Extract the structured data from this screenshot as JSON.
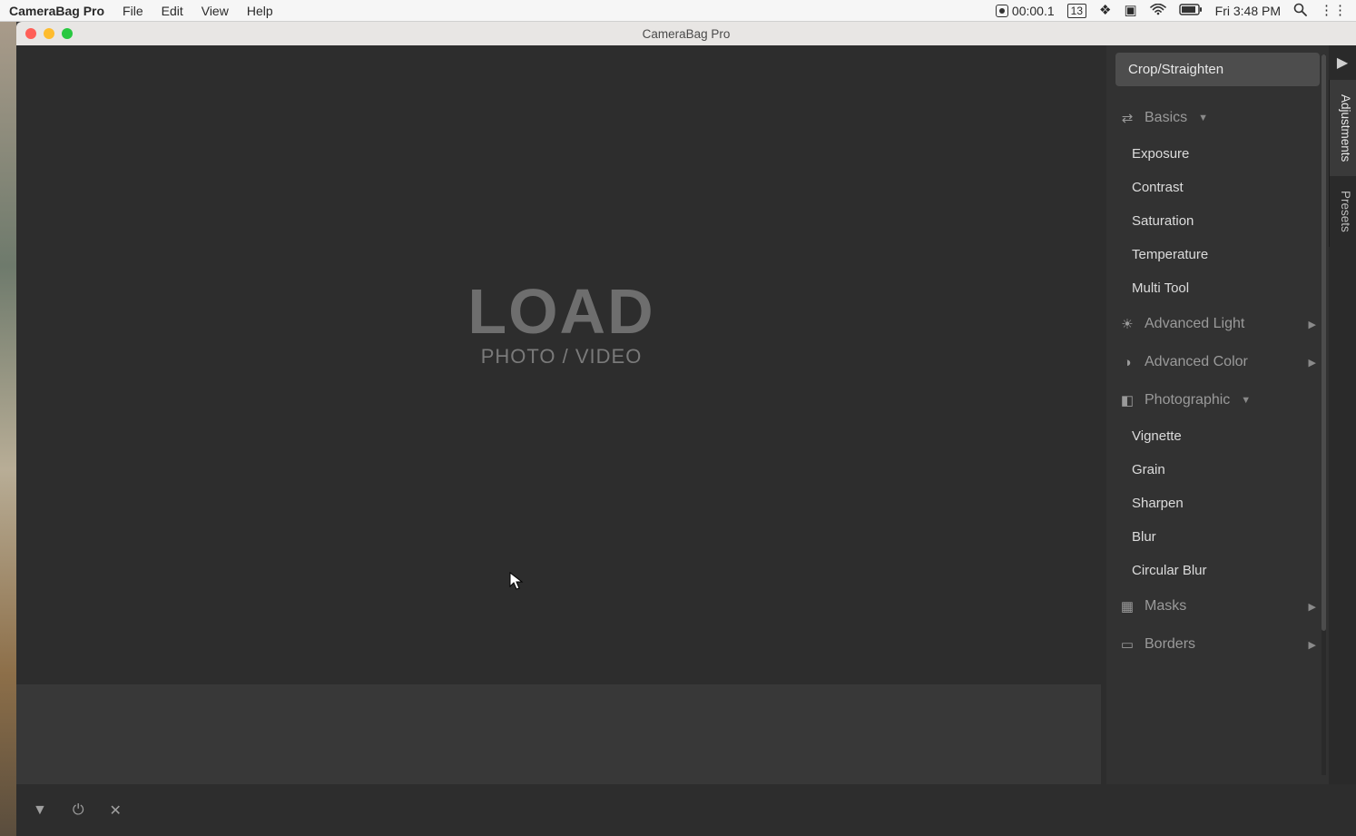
{
  "menubar": {
    "app": "CameraBag Pro",
    "items": [
      "File",
      "Edit",
      "View",
      "Help"
    ],
    "rec_time": "00:00.1",
    "date_badge": "13",
    "clock": "Fri 3:48 PM"
  },
  "window": {
    "title": "CameraBag Pro"
  },
  "canvas": {
    "load_big": "LOAD",
    "load_sub": "PHOTO / VIDEO"
  },
  "panel": {
    "crop": "Crop/Straighten",
    "sections": [
      {
        "icon": "sliders-icon",
        "label": "Basics",
        "expanded": true,
        "arrow": "down",
        "items": [
          "Exposure",
          "Contrast",
          "Saturation",
          "Temperature",
          "Multi Tool"
        ]
      },
      {
        "icon": "sun-icon",
        "label": "Advanced Light",
        "expanded": false,
        "arrow": "right",
        "items": []
      },
      {
        "icon": "palette-icon",
        "label": "Advanced Color",
        "expanded": false,
        "arrow": "right",
        "items": []
      },
      {
        "icon": "camera-icon",
        "label": "Photographic",
        "expanded": true,
        "arrow": "down",
        "items": [
          "Vignette",
          "Grain",
          "Sharpen",
          "Blur",
          "Circular Blur"
        ]
      },
      {
        "icon": "checker-icon",
        "label": "Masks",
        "expanded": false,
        "arrow": "right",
        "items": []
      },
      {
        "icon": "frame-icon",
        "label": "Borders",
        "expanded": false,
        "arrow": "right",
        "items": []
      }
    ]
  },
  "tabs": {
    "collapse": "▶",
    "adjustments": "Adjustments",
    "presets": "Presets"
  },
  "footer": {
    "arrow": "▼",
    "power": "⏻",
    "close": "✕"
  },
  "icon_glyphs": {
    "sliders-icon": "⇄",
    "sun-icon": "☀",
    "palette-icon": "◑",
    "camera-icon": "◧",
    "checker-icon": "▦",
    "frame-icon": "▭"
  }
}
